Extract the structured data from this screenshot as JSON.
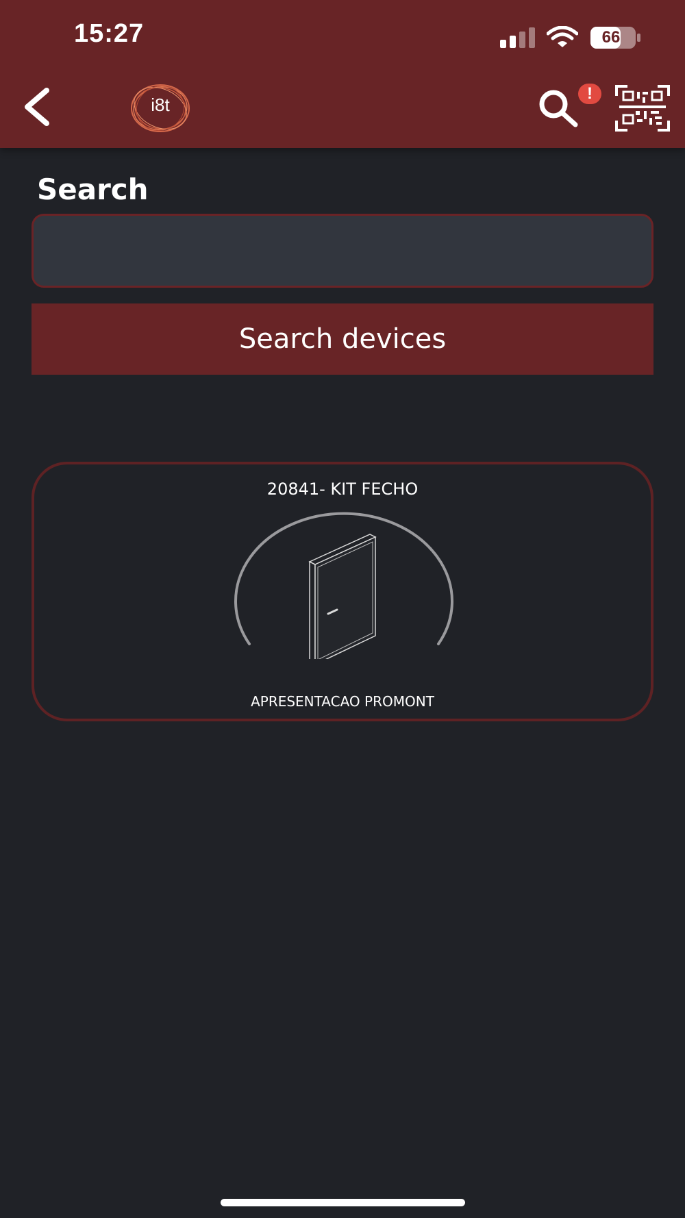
{
  "status_bar": {
    "time": "15:27",
    "battery": "66"
  },
  "app_bar": {
    "logo_text": "i8t",
    "alert_badge": "!",
    "icons": [
      "back-arrow-icon",
      "search-icon",
      "qr-code-icon"
    ]
  },
  "search": {
    "label": "Search",
    "input_value": "",
    "input_placeholder": "",
    "button_label": "Search devices"
  },
  "devices": [
    {
      "title": "20841- KIT FECHO",
      "subtitle": "APRESENTACAO PROMONT",
      "icon": "door-icon"
    }
  ],
  "colors": {
    "header": "#682426",
    "background": "#202227",
    "input_fill": "#32363e",
    "badge": "#e24a41"
  }
}
